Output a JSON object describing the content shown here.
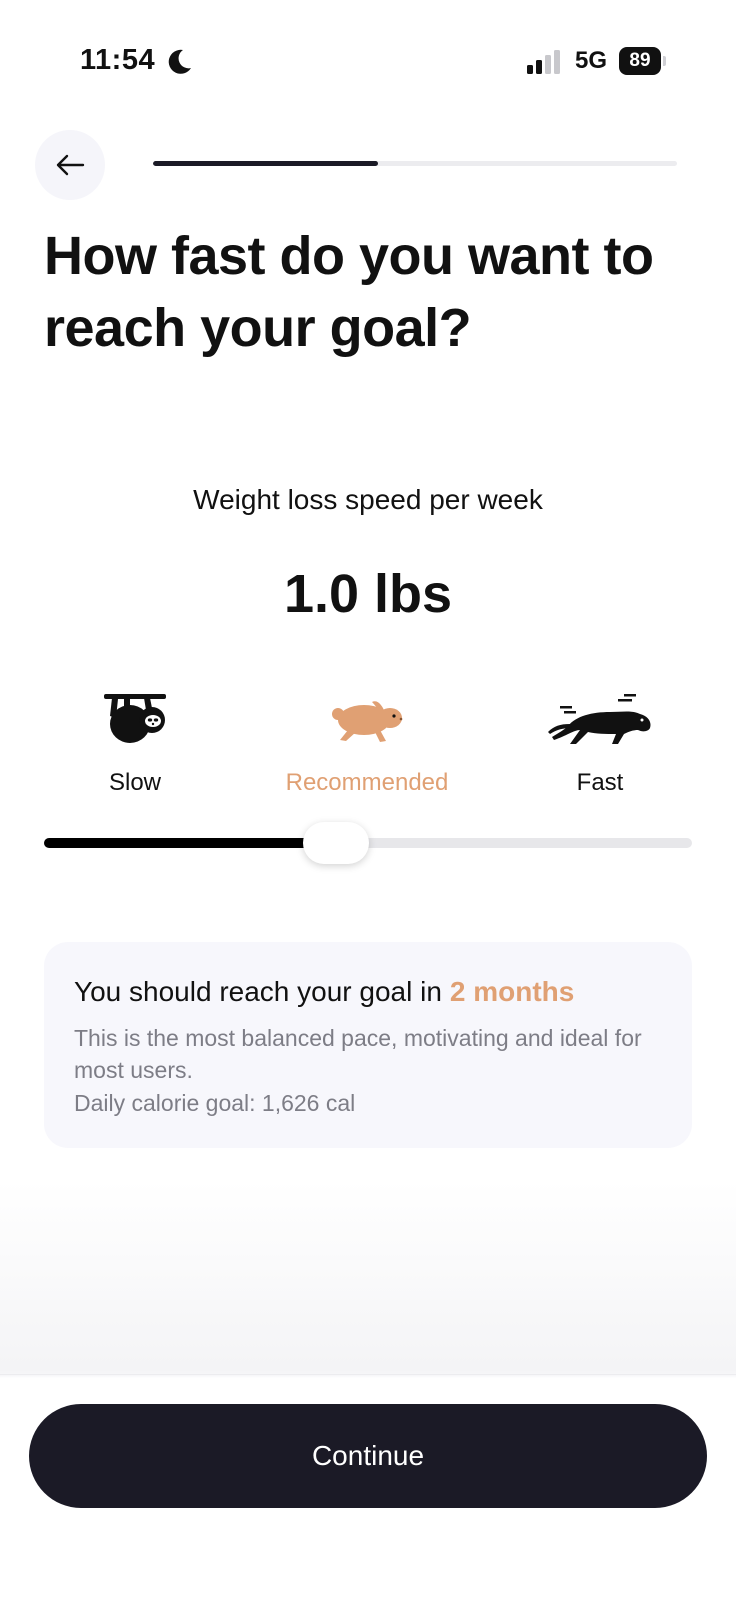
{
  "status_bar": {
    "time": "11:54",
    "network": "5G",
    "battery": "89",
    "icons": [
      "moon-icon",
      "signal-icon",
      "battery-icon"
    ]
  },
  "header": {
    "back_icon": "arrow-left-icon",
    "progress": 0.43
  },
  "title": "How fast do you want to reach your goal?",
  "speed": {
    "label": "Weight loss speed per week",
    "value": "1.0 lbs"
  },
  "paces": [
    {
      "label": "Slow",
      "icon": "sloth-icon"
    },
    {
      "label": "Recommended",
      "icon": "hare-icon"
    },
    {
      "label": "Fast",
      "icon": "panther-icon"
    }
  ],
  "slider": {
    "position": 0.45
  },
  "info_card": {
    "heading": "You should reach your goal in",
    "highlight": "2 months",
    "description": "This is the most balanced pace, motivating and ideal for most users.",
    "calories": "Daily calorie goal: 1,626 cal"
  },
  "continue_label": "Continue",
  "colors": {
    "accent": "#e0a073",
    "dark": "#1b1a26",
    "card_bg": "#f7f7fc",
    "muted_text": "#7d7d86"
  }
}
